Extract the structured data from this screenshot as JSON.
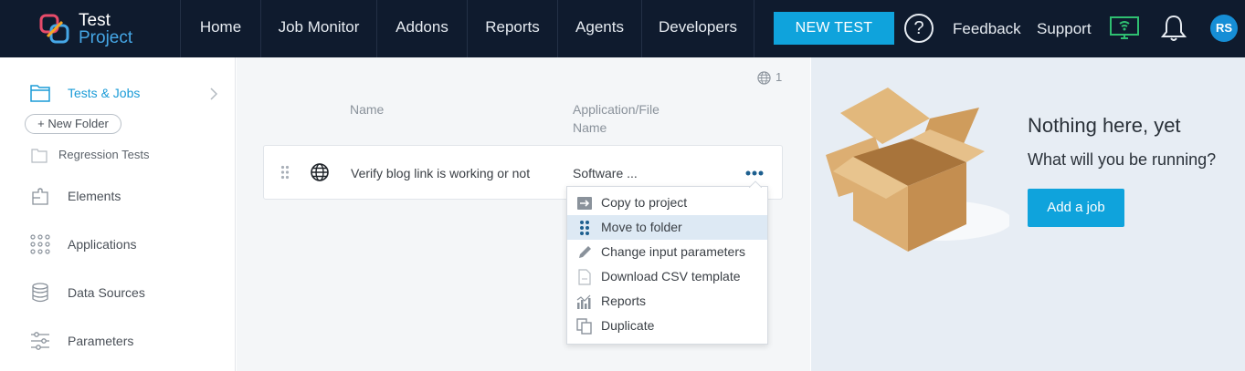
{
  "nav": {
    "logo_line1": "Test",
    "logo_line2": "Project",
    "items": [
      "Home",
      "Job Monitor",
      "Addons",
      "Reports",
      "Agents",
      "Developers"
    ],
    "new_test": "NEW TEST",
    "help": "?",
    "feedback": "Feedback",
    "support": "Support",
    "avatar": "RS",
    "colors": {
      "bar": "#0f1b2e",
      "accent": "#0fa3dc",
      "logo_blue": "#46a7e6",
      "agent_green": "#2fbf71"
    }
  },
  "sidebar": {
    "tests_jobs": "Tests & Jobs",
    "new_folder": "+ New Folder",
    "folder": "Regression Tests",
    "elements": "Elements",
    "applications": "Applications",
    "data_sources": "Data Sources",
    "parameters": "Parameters"
  },
  "main": {
    "globe_count": "1",
    "col_name": "Name",
    "col_app_line1": "Application/File",
    "col_app_line2": "Name",
    "row": {
      "name": "Verify blog link is working or not",
      "app": "Software ..."
    }
  },
  "menu": {
    "items": [
      {
        "label": "Copy to project",
        "icon": "copy-to-project-icon"
      },
      {
        "label": "Move to folder",
        "icon": "move-to-folder-icon",
        "highlighted": true
      },
      {
        "label": "Change input parameters",
        "icon": "pencil-icon"
      },
      {
        "label": "Download CSV template",
        "icon": "csv-file-icon"
      },
      {
        "label": "Reports",
        "icon": "reports-chart-icon"
      },
      {
        "label": "Duplicate",
        "icon": "duplicate-icon"
      }
    ]
  },
  "empty": {
    "title": "Nothing here, yet",
    "subtitle": "What will you be running?",
    "button": "Add a job"
  }
}
